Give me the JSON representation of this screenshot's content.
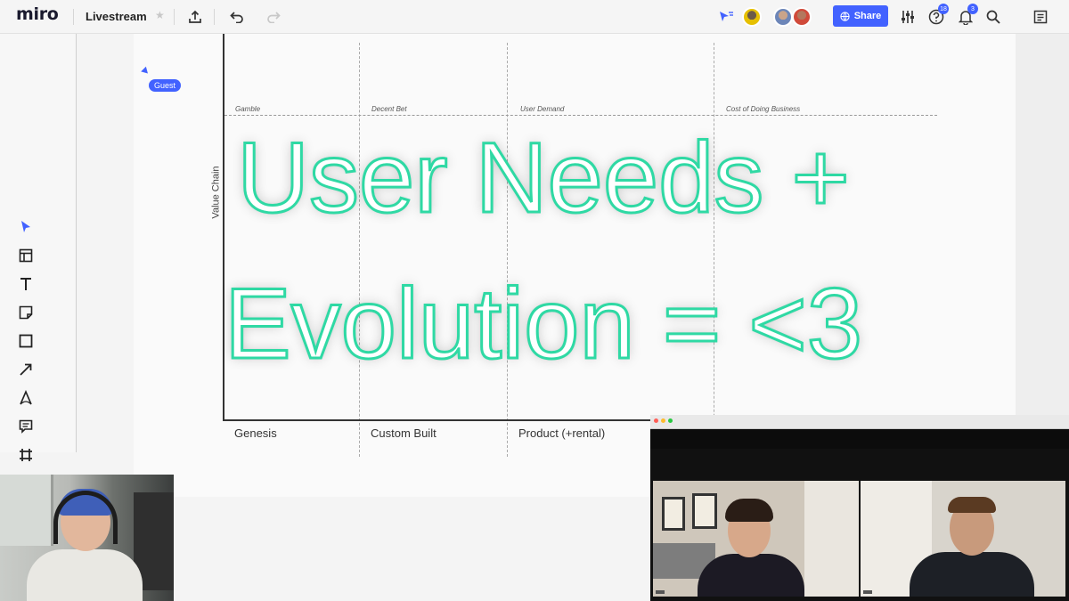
{
  "app": {
    "logo": "miro",
    "board_name": "Livestream"
  },
  "topbar": {
    "share_label": "Share",
    "help_badge": "18",
    "notifications_badge": "3"
  },
  "canvas": {
    "cursor_tag": "Guest",
    "y_axis_label": "Value Chain",
    "phase_labels": [
      "Gamble",
      "Decent Bet",
      "User Demand",
      "Cost of Doing Business"
    ],
    "stage_labels": [
      "Genesis",
      "Custom Built",
      "Product (+rental)"
    ]
  },
  "overlay": {
    "line1": "User Needs +",
    "line2": "Evolution = <3"
  },
  "colors": {
    "accent": "#4262ff",
    "overlay_outline": "#2fd9a4"
  },
  "toolbar": {
    "tools": [
      "select-icon",
      "templates-icon",
      "text-icon",
      "sticky-note-icon",
      "shape-icon",
      "arrow-icon",
      "pen-icon",
      "comment-icon",
      "frame-icon"
    ]
  }
}
